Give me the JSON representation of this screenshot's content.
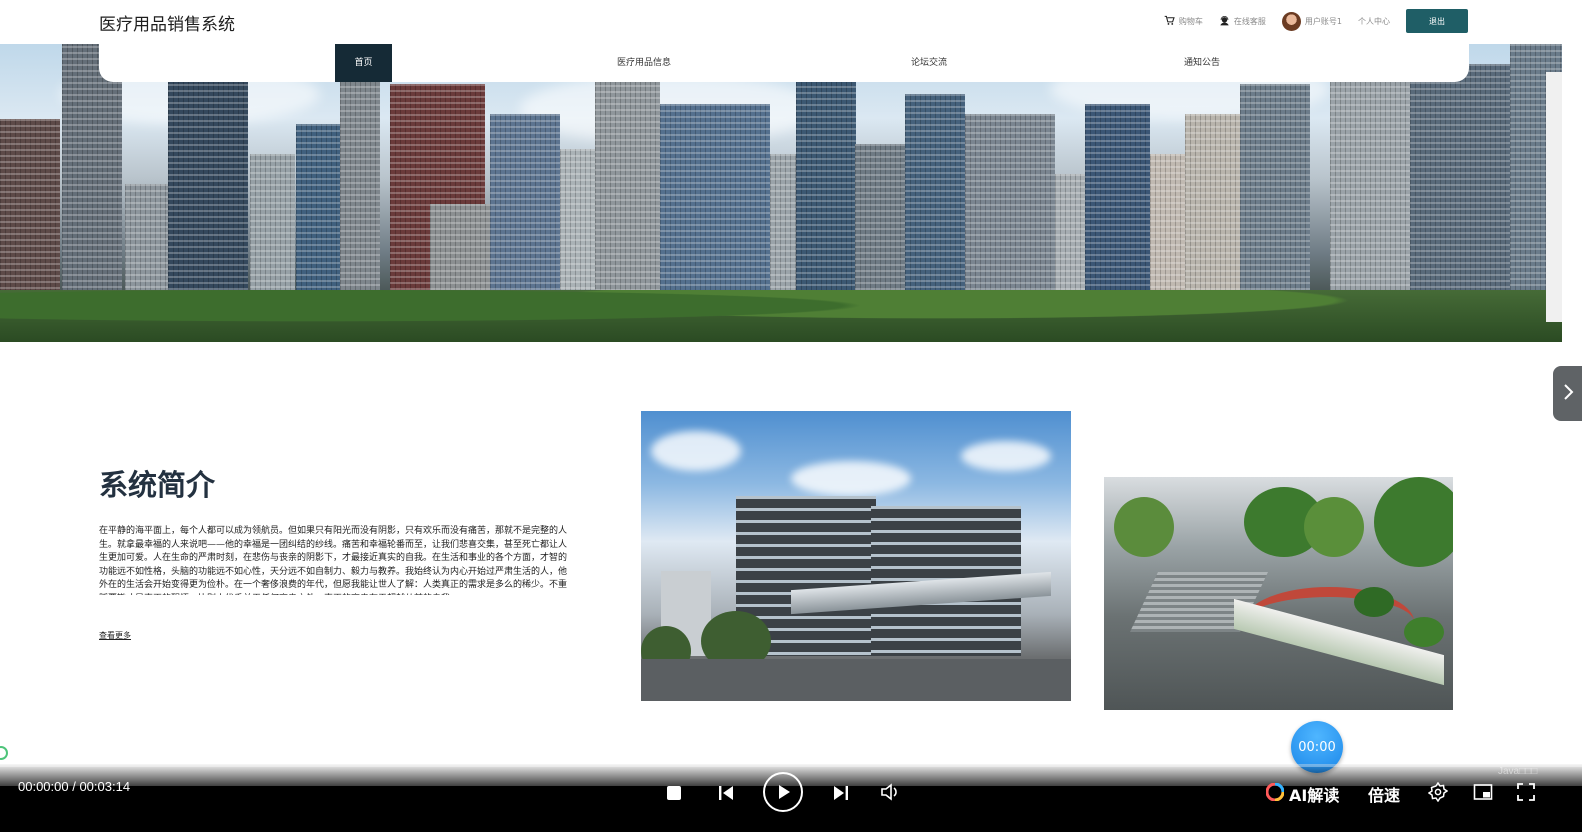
{
  "header": {
    "title": "医疗用品销售系统",
    "cart": "购物车",
    "service": "在线客服",
    "account": "用户账号1",
    "center": "个人中心",
    "logout": "退出"
  },
  "nav": {
    "items": [
      "首页",
      "医疗用品信息",
      "论坛交流",
      "通知公告"
    ]
  },
  "intro": {
    "title": "系统简介",
    "text": "在平静的海平面上，每个人都可以成为领航员。但如果只有阳光而没有阴影，只有欢乐而没有痛苦，那就不是完整的人生。就拿最幸福的人来说吧——他的幸福是一团纠结的纱线。痛苦和幸福轮番而至，让我们悲喜交集，甚至死亡都让人生更加可爱。人在生命的严肃时刻，在悲伤与丧亲的阴影下，才最接近真实的自我。在生活和事业的各个方面，才智的功能远不如性格，头脑的功能远不如心性，天分远不如自制力、毅力与教养。我始终认为内心开始过严肃生活的人，他外在的生活会开始变得更为俭朴。在一个奢侈浪费的年代，但愿我能让世人了解：人类真正的需求是多么的稀少。不重蹈覆辙才是真正的醒悟。比别人优秀并无任何高贵之处，真正的高贵在于超越从前的自我。",
    "read_more": "查看更多"
  },
  "floating": {
    "timer": "00:00"
  },
  "player": {
    "time": "00:00:00 / 00:03:14",
    "ai_label": "AI解读",
    "speed_label": "倍速",
    "watermark": "Java□□□"
  }
}
